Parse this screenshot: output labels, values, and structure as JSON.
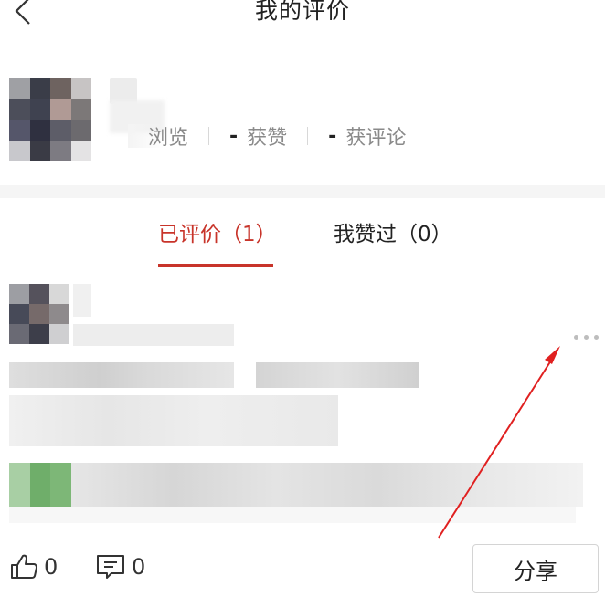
{
  "header": {
    "title": "我的评价"
  },
  "profile": {
    "stats": [
      {
        "value": "",
        "label": "浏览"
      },
      {
        "value": "-",
        "label": "获赞"
      },
      {
        "value": "-",
        "label": "获评论"
      }
    ]
  },
  "tabs": [
    {
      "label": "已评价（1）",
      "active": true
    },
    {
      "label": "我赞过（0）",
      "active": false
    }
  ],
  "post": {
    "like_count": "0",
    "comment_count": "0",
    "share_label": "分享"
  },
  "colors": {
    "accent": "#c8342a",
    "annotation": "#e02020",
    "green_thumb": "#6fae6a"
  },
  "icons": [
    "back-icon",
    "thumbs-up-icon",
    "comment-icon",
    "more-icon"
  ]
}
